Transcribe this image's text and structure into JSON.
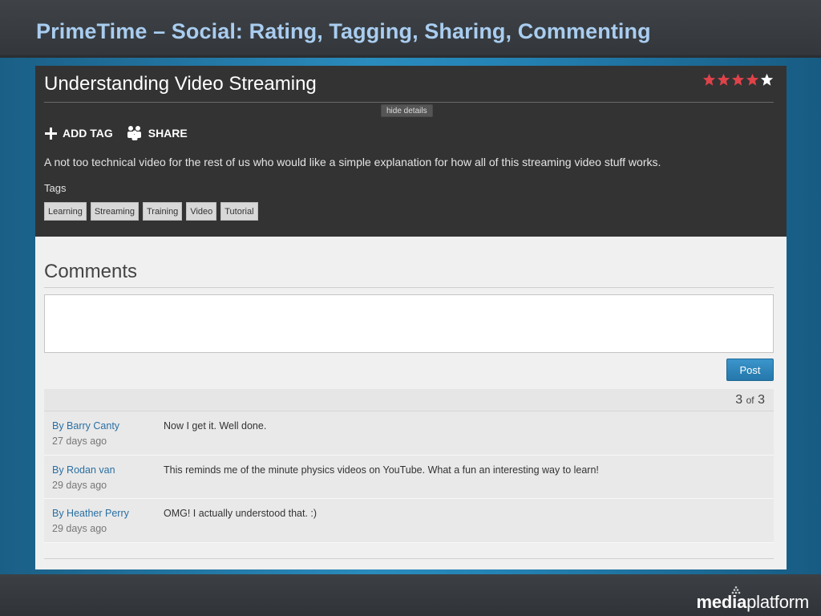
{
  "slide": {
    "title": "PrimeTime – Social: Rating, Tagging, Sharing, Commenting",
    "logo_bold": "media",
    "logo_regular": "platform"
  },
  "video": {
    "title": "Understanding Video Streaming",
    "rating": {
      "value": 4,
      "max": 5,
      "filled_color": "#e0424a",
      "empty_color": "#ffffff"
    },
    "hide_details_label": "hide details",
    "add_tag_label": "ADD TAG",
    "share_label": "SHARE",
    "description": "A not too technical video for the rest of us who would like a simple explanation for how all of this streaming video stuff works.",
    "tags_label": "Tags",
    "tags": [
      "Learning",
      "Streaming",
      "Training",
      "Video",
      "Tutorial"
    ]
  },
  "comments": {
    "heading": "Comments",
    "input_value": "",
    "post_label": "Post",
    "pager": {
      "current": "3",
      "of_label": "of",
      "total": "3"
    },
    "items": [
      {
        "author": "By Barry Canty",
        "time": "27 days ago",
        "text": "Now I get it. Well done."
      },
      {
        "author": "By Rodan van",
        "time": "29 days ago",
        "text": "This reminds me of the minute physics videos on YouTube. What a fun an interesting way to learn!"
      },
      {
        "author": "By Heather Perry",
        "time": "29 days ago",
        "text": "OMG! I actually understood that. :)"
      }
    ]
  },
  "colors": {
    "accent_blue": "#2a6fa3",
    "button_blue": "#2e86bd",
    "title_blue": "#a9cdf0",
    "dark_panel": "#333333"
  }
}
